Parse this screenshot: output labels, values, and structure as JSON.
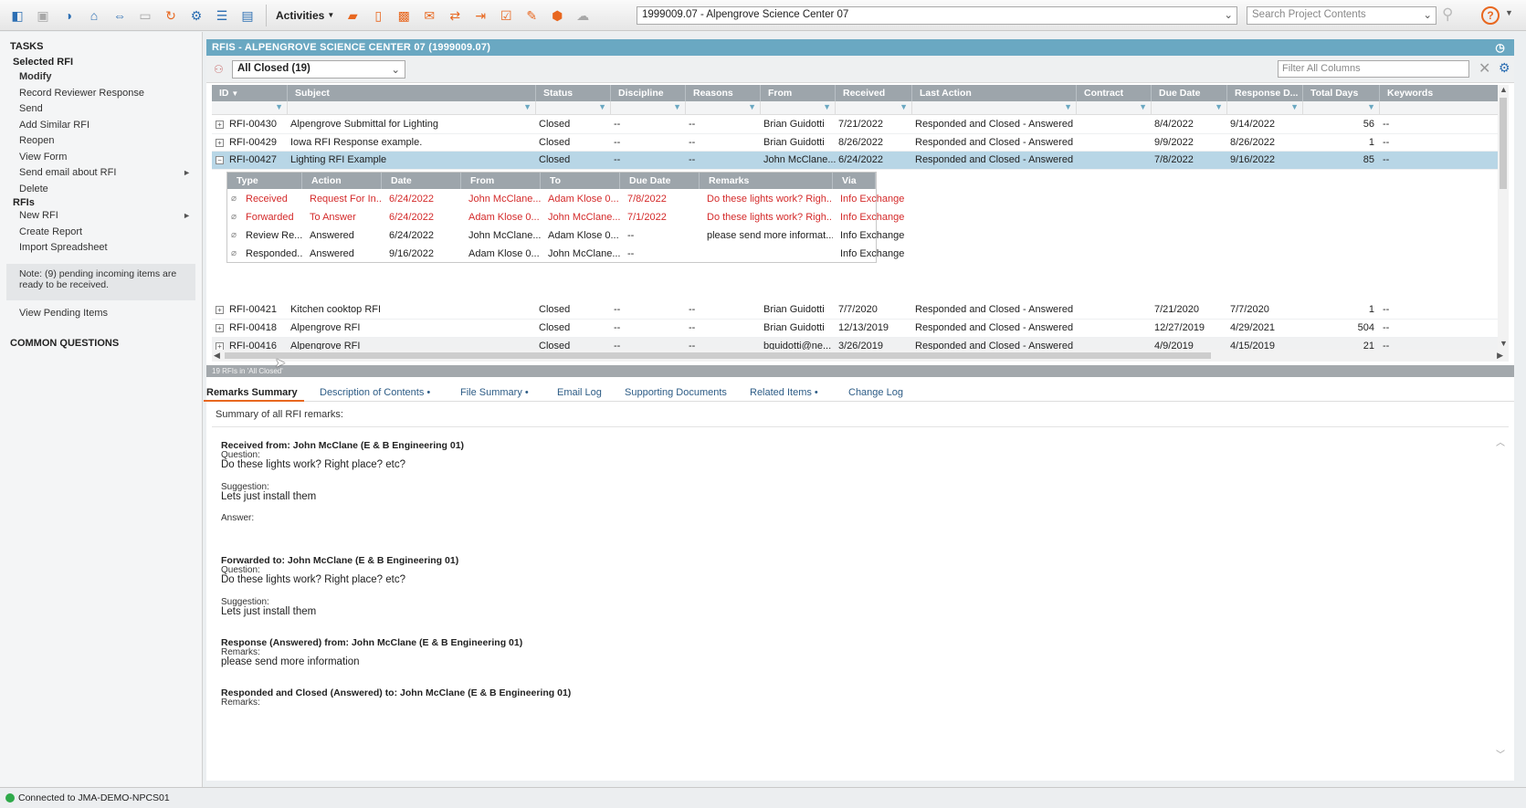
{
  "toolbar": {
    "activities_label": "Activities",
    "project": "1999009.07 - Alpengrove Science Center 07",
    "search_placeholder": "Search Project Contents"
  },
  "sidebar": {
    "tasks_heading": "TASKS",
    "selected_rfi_heading": "Selected RFI",
    "selected_items": [
      {
        "label": "Modify"
      },
      {
        "label": "Record Reviewer Response"
      },
      {
        "label": "Send"
      },
      {
        "label": "Add Similar RFI"
      },
      {
        "label": "Reopen"
      },
      {
        "label": "View Form"
      },
      {
        "label": "Send email about RFI"
      },
      {
        "label": "Delete"
      }
    ],
    "rfis_heading": "RFIs",
    "rfi_items": [
      {
        "label": "New RFI"
      },
      {
        "label": "Create Report"
      },
      {
        "label": "Import Spreadsheet"
      }
    ],
    "note": "Note: (9) pending incoming items are ready to be received.",
    "view_pending": "View Pending Items",
    "common_questions": "COMMON QUESTIONS"
  },
  "main": {
    "title": "RFIS - ALPENGROVE SCIENCE CENTER 07 (1999009.07)",
    "view": "All Closed (19)",
    "filter_placeholder": "Filter All Columns",
    "columns": [
      "ID",
      "Subject",
      "Status",
      "Discipline",
      "Reasons",
      "From",
      "Received",
      "Last Action",
      "Contract",
      "Due Date",
      "Response D...",
      "Total Days",
      "Keywords"
    ],
    "rows": [
      {
        "id": "RFI-00430",
        "subject": "Alpengrove Submittal for Lighting",
        "status": "Closed",
        "discipline": "--",
        "reasons": "--",
        "from": "Brian Guidotti",
        "received": "7/21/2022",
        "last_action": "Responded and Closed - Answered",
        "contract": "",
        "due": "8/4/2022",
        "response": "9/14/2022",
        "total": "56",
        "keywords": "--"
      },
      {
        "id": "RFI-00429",
        "subject": "Iowa RFI Response example.",
        "status": "Closed",
        "discipline": "--",
        "reasons": "--",
        "from": "Brian Guidotti",
        "received": "8/26/2022",
        "last_action": "Responded and Closed - Answered",
        "contract": "",
        "due": "9/9/2022",
        "response": "8/26/2022",
        "total": "1",
        "keywords": "--"
      },
      {
        "id": "RFI-00427",
        "subject": "Lighting RFI Example",
        "status": "Closed",
        "discipline": "--",
        "reasons": "--",
        "from": "John McClane...",
        "received": "6/24/2022",
        "last_action": "Responded and Closed - Answered",
        "contract": "",
        "due": "7/8/2022",
        "response": "9/16/2022",
        "total": "85",
        "keywords": "--"
      },
      {
        "id": "RFI-00421",
        "subject": "Kitchen cooktop RFI",
        "status": "Closed",
        "discipline": "--",
        "reasons": "--",
        "from": "Brian Guidotti",
        "received": "7/7/2020",
        "last_action": "Responded and Closed - Answered",
        "contract": "",
        "due": "7/21/2020",
        "response": "7/7/2020",
        "total": "1",
        "keywords": "--"
      },
      {
        "id": "RFI-00418",
        "subject": "Alpengrove RFI",
        "status": "Closed",
        "discipline": "--",
        "reasons": "--",
        "from": "Brian Guidotti",
        "received": "12/13/2019",
        "last_action": "Responded and Closed - Answered",
        "contract": "",
        "due": "12/27/2019",
        "response": "4/29/2021",
        "total": "504",
        "keywords": "--"
      },
      {
        "id": "RFI-00416",
        "subject": "Alpengrove RFI",
        "status": "Closed",
        "discipline": "--",
        "reasons": "--",
        "from": "bguidotti@ne...",
        "received": "3/26/2019",
        "last_action": "Responded and Closed - Answered",
        "contract": "",
        "due": "4/9/2019",
        "response": "4/15/2019",
        "total": "21",
        "keywords": "--"
      }
    ],
    "sub_columns": [
      "Type",
      "Action",
      "Date",
      "From",
      "To",
      "Due Date",
      "Remarks",
      "Via"
    ],
    "sub_rows": [
      {
        "type": "Received",
        "action": "Request For In...",
        "date": "6/24/2022",
        "from": "John McClane...",
        "to": "Adam Klose 0...",
        "due": "7/8/2022",
        "remarks": "Do these lights work? Righ...",
        "via": "Info Exchange"
      },
      {
        "type": "Forwarded",
        "action": "To Answer",
        "date": "6/24/2022",
        "from": "Adam Klose 0...",
        "to": "John McClane...",
        "due": "7/1/2022",
        "remarks": "Do these lights work? Righ...",
        "via": "Info Exchange"
      },
      {
        "type": "Review Re...",
        "action": "Answered",
        "date": "6/24/2022",
        "from": "John McClane...",
        "to": "Adam Klose 0...",
        "due": "--",
        "remarks": "please send more informat...",
        "via": "Info Exchange"
      },
      {
        "type": "Responded...",
        "action": "Answered",
        "date": "9/16/2022",
        "from": "Adam Klose 0...",
        "to": "John McClane...",
        "due": "--",
        "remarks": "",
        "via": "Info Exchange"
      }
    ],
    "count_text": "19 RFIs in 'All Closed'"
  },
  "tabs": [
    {
      "label": "Remarks Summary"
    },
    {
      "label": "Description of Contents •"
    },
    {
      "label": "File Summary •"
    },
    {
      "label": "Email Log"
    },
    {
      "label": "Supporting Documents"
    },
    {
      "label": "Related Items •"
    },
    {
      "label": "Change Log"
    }
  ],
  "remarks": {
    "caption": "Summary of all RFI remarks:",
    "received_heading": "Received from: John McClane (E & B Engineering 01)",
    "question_label": "Question:",
    "question_text": "Do these lights work? Right place? etc?",
    "suggestion_label": "Suggestion:",
    "suggestion_text": "Lets just install them",
    "answer_label": "Answer:",
    "forwarded_heading": "Forwarded to: John McClane (E & B Engineering 01)",
    "question_text_2": "Do these lights work? Right place? etc?",
    "suggestion_text_2": "Lets just install them",
    "response_heading": "Response (Answered) from: John McClane (E & B Engineering 01)",
    "remarks_label": "Remarks:",
    "response_text": "please send more information",
    "closed_heading": "Responded and Closed (Answered) to: John McClane (E & B Engineering 01)",
    "remarks_label_2": "Remarks:"
  },
  "statusbar": {
    "connection": "Connected to JMA-DEMO-NPCS01"
  }
}
